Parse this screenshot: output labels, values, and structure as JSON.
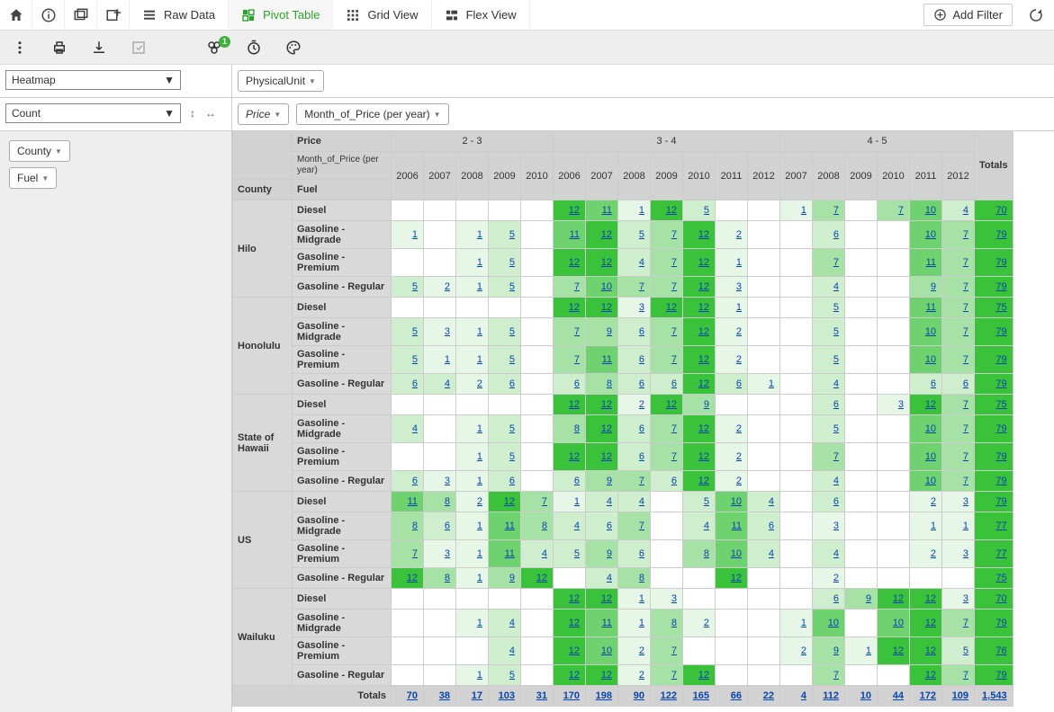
{
  "toolbar": {
    "raw": "Raw Data",
    "pivot": "Pivot Table",
    "grid": "Grid View",
    "flex": "Flex View",
    "addfilter": "Add Filter",
    "badge": "1"
  },
  "cfg": {
    "viz": "Heatmap",
    "agg": "Count",
    "colfield": "PhysicalUnit",
    "val": "Price",
    "colsub": "Month_of_Price (per year)"
  },
  "rowfields": [
    "County",
    "Fuel"
  ],
  "head": {
    "price": "Price",
    "mop": "Month_of_Price (per year)",
    "county": "County",
    "fuel": "Fuel",
    "totals": "Totals"
  },
  "priceBands": [
    "2 - 3",
    "3 - 4",
    "4 - 5"
  ],
  "years": [
    [
      "2006",
      "2007",
      "2008",
      "2009",
      "2010"
    ],
    [
      "2006",
      "2007",
      "2008",
      "2009",
      "2010",
      "2011",
      "2012"
    ],
    [
      "2007",
      "2008",
      "2009",
      "2010",
      "2011",
      "2012"
    ]
  ],
  "counties": [
    "Hilo",
    "Honolulu",
    "State of Hawaii",
    "US",
    "Wailuku"
  ],
  "fuels": [
    "Diesel",
    "Gasoline - Midgrade",
    "Gasoline - Premium",
    "Gasoline - Regular"
  ],
  "chart_data": {
    "type": "heatmap",
    "title": "Count by County × Fuel vs Price band × Year",
    "rows_dim": [
      "County",
      "Fuel"
    ],
    "cols_dim": [
      "Price",
      "Month_of_Price (per year)"
    ],
    "rows": [
      {
        "county": "Hilo",
        "fuel": "Diesel",
        "cells": [
          null,
          null,
          null,
          null,
          null,
          12,
          11,
          1,
          12,
          5,
          null,
          null,
          1,
          7,
          null,
          7,
          10,
          4
        ],
        "total": 70
      },
      {
        "county": "Hilo",
        "fuel": "Gasoline - Midgrade",
        "cells": [
          1,
          null,
          1,
          5,
          null,
          11,
          12,
          5,
          7,
          12,
          2,
          null,
          null,
          6,
          null,
          null,
          10,
          7
        ],
        "total": 79
      },
      {
        "county": "Hilo",
        "fuel": "Gasoline - Premium",
        "cells": [
          null,
          null,
          1,
          5,
          null,
          12,
          12,
          4,
          7,
          12,
          1,
          null,
          null,
          7,
          null,
          null,
          11,
          7
        ],
        "total": 79
      },
      {
        "county": "Hilo",
        "fuel": "Gasoline - Regular",
        "cells": [
          5,
          2,
          1,
          5,
          null,
          7,
          10,
          7,
          7,
          12,
          3,
          null,
          null,
          4,
          null,
          null,
          9,
          7
        ],
        "total": 79
      },
      {
        "county": "Honolulu",
        "fuel": "Diesel",
        "cells": [
          null,
          null,
          null,
          null,
          null,
          12,
          12,
          3,
          12,
          12,
          1,
          null,
          null,
          5,
          null,
          null,
          11,
          7
        ],
        "total": 75
      },
      {
        "county": "Honolulu",
        "fuel": "Gasoline - Midgrade",
        "cells": [
          5,
          3,
          1,
          5,
          null,
          7,
          9,
          6,
          7,
          12,
          2,
          null,
          null,
          5,
          null,
          null,
          10,
          7
        ],
        "total": 79
      },
      {
        "county": "Honolulu",
        "fuel": "Gasoline - Premium",
        "cells": [
          5,
          1,
          1,
          5,
          null,
          7,
          11,
          6,
          7,
          12,
          2,
          null,
          null,
          5,
          null,
          null,
          10,
          7
        ],
        "total": 79
      },
      {
        "county": "Honolulu",
        "fuel": "Gasoline - Regular",
        "cells": [
          6,
          4,
          2,
          6,
          null,
          6,
          8,
          6,
          6,
          12,
          6,
          1,
          null,
          4,
          null,
          null,
          6,
          6
        ],
        "total": 79
      },
      {
        "county": "State of Hawaii",
        "fuel": "Diesel",
        "cells": [
          null,
          null,
          null,
          null,
          null,
          12,
          12,
          2,
          12,
          9,
          null,
          null,
          null,
          6,
          null,
          3,
          12,
          7
        ],
        "total": 75
      },
      {
        "county": "State of Hawaii",
        "fuel": "Gasoline - Midgrade",
        "cells": [
          4,
          null,
          1,
          5,
          null,
          8,
          12,
          6,
          7,
          12,
          2,
          null,
          null,
          5,
          null,
          null,
          10,
          7
        ],
        "total": 79
      },
      {
        "county": "State of Hawaii",
        "fuel": "Gasoline - Premium",
        "cells": [
          null,
          null,
          1,
          5,
          null,
          12,
          12,
          6,
          7,
          12,
          2,
          null,
          null,
          7,
          null,
          null,
          10,
          7
        ],
        "total": 79
      },
      {
        "county": "State of Hawaii",
        "fuel": "Gasoline - Regular",
        "cells": [
          6,
          3,
          1,
          6,
          null,
          6,
          9,
          7,
          6,
          12,
          2,
          null,
          null,
          4,
          null,
          null,
          10,
          7
        ],
        "total": 79
      },
      {
        "county": "US",
        "fuel": "Diesel",
        "cells": [
          11,
          8,
          2,
          12,
          7,
          1,
          4,
          4,
          null,
          5,
          10,
          4,
          null,
          6,
          null,
          null,
          2,
          3
        ],
        "total": 79
      },
      {
        "county": "US",
        "fuel": "Gasoline - Midgrade",
        "cells": [
          8,
          6,
          1,
          11,
          8,
          4,
          6,
          7,
          null,
          4,
          11,
          6,
          null,
          3,
          null,
          null,
          1,
          1
        ],
        "total": 77
      },
      {
        "county": "US",
        "fuel": "Gasoline - Premium",
        "cells": [
          7,
          3,
          1,
          11,
          4,
          5,
          9,
          6,
          null,
          8,
          10,
          4,
          null,
          4,
          null,
          null,
          2,
          3
        ],
        "total": 77
      },
      {
        "county": "US",
        "fuel": "Gasoline - Regular",
        "cells": [
          12,
          8,
          1,
          9,
          12,
          null,
          4,
          8,
          null,
          null,
          12,
          null,
          null,
          2,
          null,
          null,
          null,
          null
        ],
        "total": 75
      },
      {
        "county": "Wailuku",
        "fuel": "Diesel",
        "cells": [
          null,
          null,
          null,
          null,
          null,
          12,
          12,
          1,
          3,
          null,
          null,
          null,
          null,
          6,
          9,
          12,
          12,
          3
        ],
        "total": 70
      },
      {
        "county": "Wailuku",
        "fuel": "Gasoline - Midgrade",
        "cells": [
          null,
          null,
          1,
          4,
          null,
          12,
          11,
          1,
          8,
          2,
          null,
          null,
          1,
          10,
          null,
          10,
          12,
          7
        ],
        "total": 79
      },
      {
        "county": "Wailuku",
        "fuel": "Gasoline - Premium",
        "cells": [
          null,
          null,
          null,
          4,
          null,
          12,
          10,
          2,
          7,
          null,
          null,
          null,
          2,
          9,
          1,
          12,
          12,
          5
        ],
        "total": 76
      },
      {
        "county": "Wailuku",
        "fuel": "Gasoline - Regular",
        "cells": [
          null,
          null,
          1,
          5,
          null,
          12,
          12,
          2,
          7,
          12,
          null,
          null,
          null,
          7,
          null,
          null,
          12,
          7
        ],
        "total": 79
      }
    ],
    "col_totals": [
      70,
      38,
      17,
      103,
      31,
      170,
      198,
      90,
      122,
      165,
      66,
      22,
      4,
      112,
      10,
      44,
      172,
      109
    ],
    "grand_total": "1,543",
    "totals_label": "Totals"
  }
}
